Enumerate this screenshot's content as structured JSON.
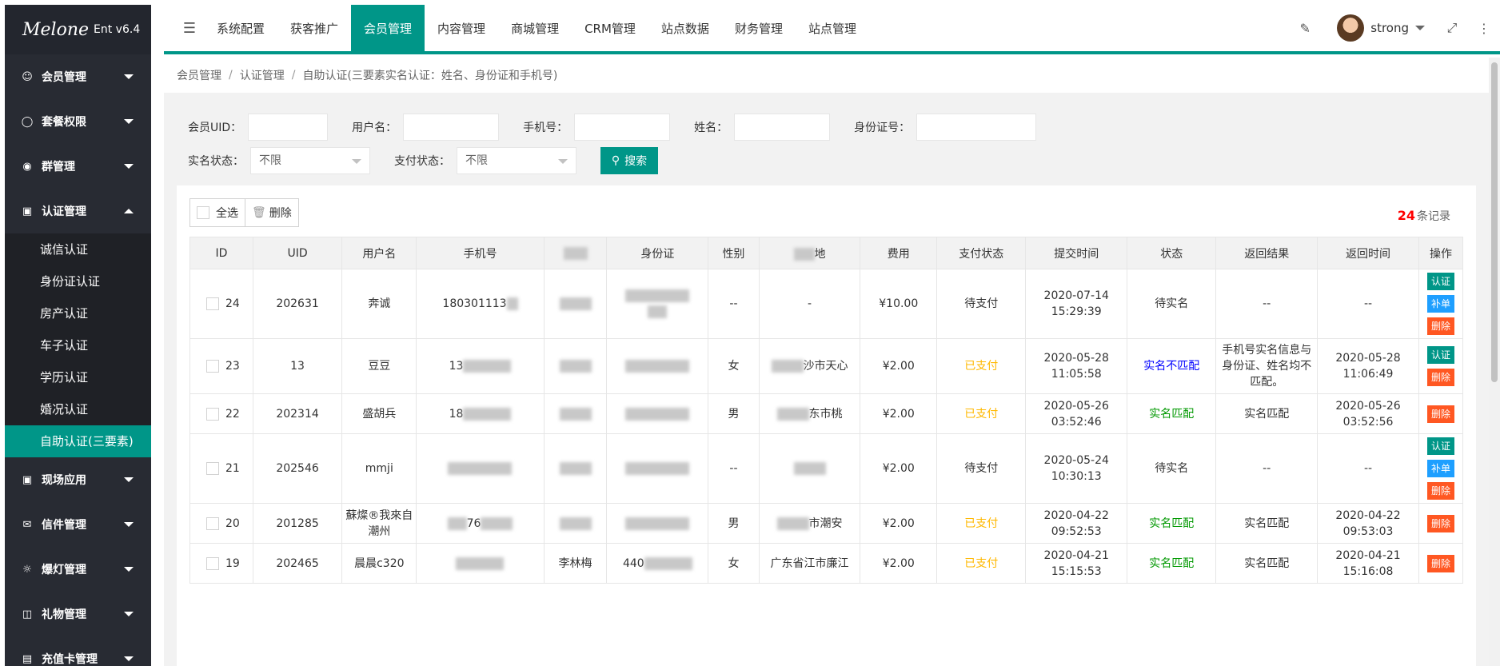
{
  "logo": {
    "brand": "Melone",
    "version": "Ent v6.4"
  },
  "sidebar": {
    "items": [
      {
        "label": "会员管理",
        "icon": "member-icon"
      },
      {
        "label": "套餐权限",
        "icon": "package-icon"
      },
      {
        "label": "群管理",
        "icon": "group-icon"
      },
      {
        "label": "认证管理",
        "icon": "auth-icon"
      },
      {
        "label": "现场应用",
        "icon": "app-icon"
      },
      {
        "label": "信件管理",
        "icon": "mail-icon"
      },
      {
        "label": "爆灯管理",
        "icon": "light-icon"
      },
      {
        "label": "礼物管理",
        "icon": "gift-icon"
      },
      {
        "label": "充值卡管理",
        "icon": "card-icon"
      }
    ],
    "sub_items": [
      "诚信认证",
      "身份证认证",
      "房产认证",
      "车子认证",
      "学历认证",
      "婚况认证",
      "自助认证(三要素)"
    ]
  },
  "topnav": {
    "items": [
      "系统配置",
      "获客推广",
      "会员管理",
      "内容管理",
      "商城管理",
      "CRM管理",
      "站点数据",
      "财务管理",
      "站点管理"
    ],
    "active_index": 2,
    "user": "strong"
  },
  "breadcrumb": [
    "会员管理",
    "认证管理",
    "自助认证(三要素实名认证：姓名、身份证和手机号)"
  ],
  "filters": {
    "uid_label": "会员UID：",
    "username_label": "用户名：",
    "mobile_label": "手机号：",
    "name_label": "姓名：",
    "idcard_label": "身份证号：",
    "realname_status_label": "实名状态：",
    "realname_status_value": "不限",
    "pay_status_label": "支付状态：",
    "pay_status_value": "不限",
    "search_label": "搜索"
  },
  "toolbar": {
    "select_all": "全选",
    "delete": "删除"
  },
  "records": {
    "count": "24",
    "suffix": "条记录"
  },
  "table": {
    "headers": [
      "ID",
      "UID",
      "用户名",
      "手机号",
      "",
      "身份证",
      "性别",
      "地",
      "费用",
      "支付状态",
      "提交时间",
      "状态",
      "返回结果",
      "返回时间",
      "操作"
    ],
    "rows": [
      {
        "id": "24",
        "uid": "202631",
        "username": "奔诚",
        "mobile": "180301113",
        "gender": "--",
        "fee": "¥10.00",
        "pay": "待支付",
        "pay_cls": "pending",
        "submit": "2020-07-14 15:29:39",
        "status": "待实名",
        "status_cls": "pending",
        "result": "--",
        "return_time": "--",
        "ops": [
          "认证",
          "补单",
          "删除"
        ]
      },
      {
        "id": "23",
        "uid": "13",
        "username": "豆豆",
        "mobile": "13",
        "gender": "女",
        "addr": "沙市天心",
        "fee": "¥2.00",
        "pay": "已支付",
        "pay_cls": "paid",
        "submit": "2020-05-28 11:05:58",
        "status": "实名不匹配",
        "status_cls": "mismatch",
        "result": "手机号实名信息与身份证、姓名均不匹配。",
        "return_time": "2020-05-28 11:06:49",
        "ops": [
          "认证",
          "删除"
        ]
      },
      {
        "id": "22",
        "uid": "202314",
        "username": "盛胡兵",
        "mobile": "18",
        "gender": "男",
        "addr": "东市桃",
        "fee": "¥2.00",
        "pay": "已支付",
        "pay_cls": "paid",
        "submit": "2020-05-26 03:52:46",
        "status": "实名匹配",
        "status_cls": "match",
        "result": "实名匹配",
        "return_time": "2020-05-26 03:52:56",
        "ops": [
          "删除"
        ]
      },
      {
        "id": "21",
        "uid": "202546",
        "username": "mmji",
        "mobile": "",
        "gender": "--",
        "fee": "¥2.00",
        "pay": "待支付",
        "pay_cls": "pending",
        "submit": "2020-05-24 10:30:13",
        "status": "待实名",
        "status_cls": "pending",
        "result": "--",
        "return_time": "--",
        "ops": [
          "认证",
          "补单",
          "删除"
        ]
      },
      {
        "id": "20",
        "uid": "201285",
        "username": "蘇燦®我來自潮州",
        "mobile": "76",
        "gender": "男",
        "addr": "市潮安",
        "fee": "¥2.00",
        "pay": "已支付",
        "pay_cls": "paid",
        "submit": "2020-04-22 09:52:53",
        "status": "实名匹配",
        "status_cls": "match",
        "result": "实名匹配",
        "return_time": "2020-04-22 09:53:03",
        "ops": [
          "删除"
        ]
      },
      {
        "id": "19",
        "uid": "202465",
        "username": "晨晨c320",
        "mobile": "",
        "name": "李林梅",
        "idcard": "440",
        "gender": "女",
        "addr": "广东省江市廉江",
        "fee": "¥2.00",
        "pay": "已支付",
        "pay_cls": "paid",
        "submit": "2020-04-21 15:15:53",
        "status": "实名匹配",
        "status_cls": "match",
        "result": "实名匹配",
        "return_time": "2020-04-21 15:16:08",
        "ops": [
          "删除"
        ]
      }
    ]
  }
}
